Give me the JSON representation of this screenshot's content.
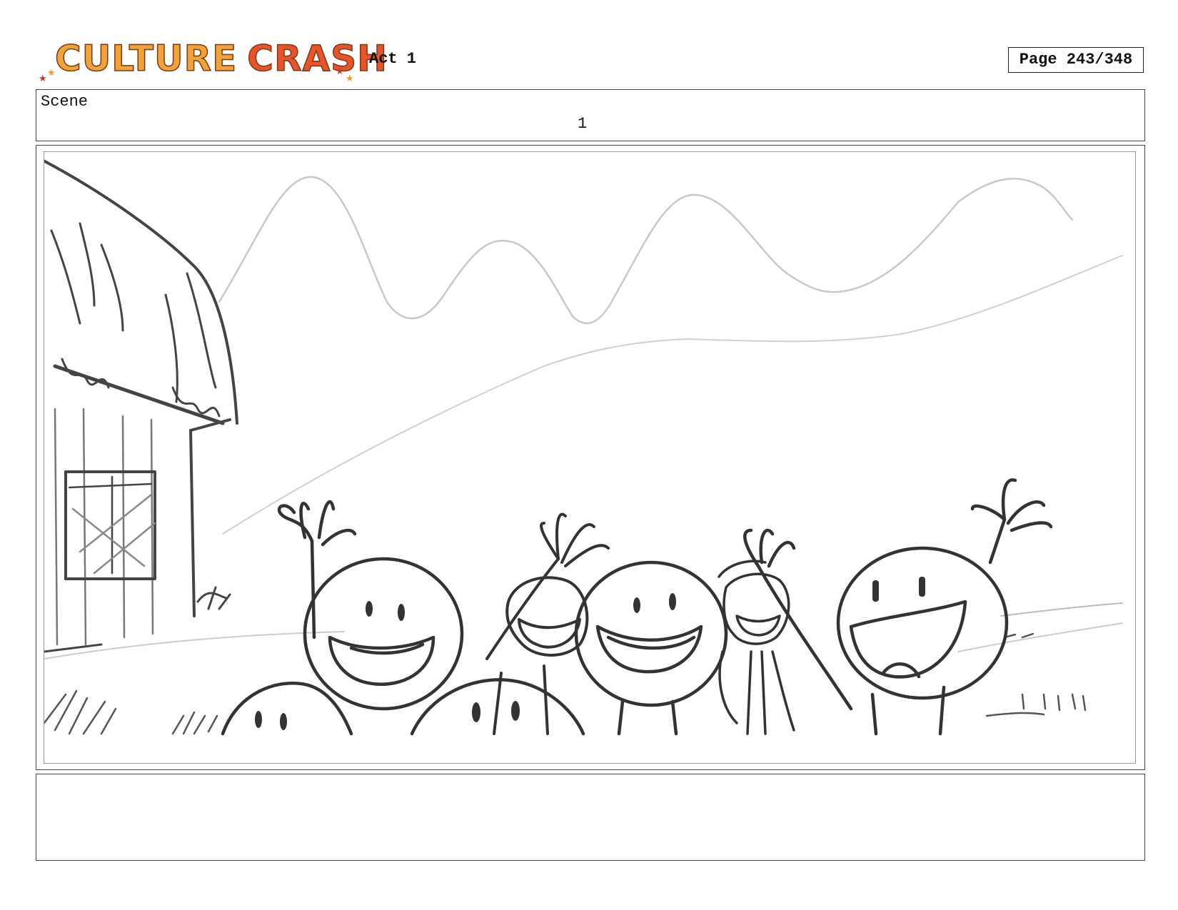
{
  "header": {
    "logo": {
      "word1": "CULTURE",
      "word2": "CRASH",
      "color_word1": "#f2a23a",
      "color_word2": "#e8532b"
    },
    "act": "Act 1",
    "page": "Page 243/348"
  },
  "scene": {
    "label": "Scene",
    "number": "1"
  },
  "notes": {
    "text": ""
  }
}
